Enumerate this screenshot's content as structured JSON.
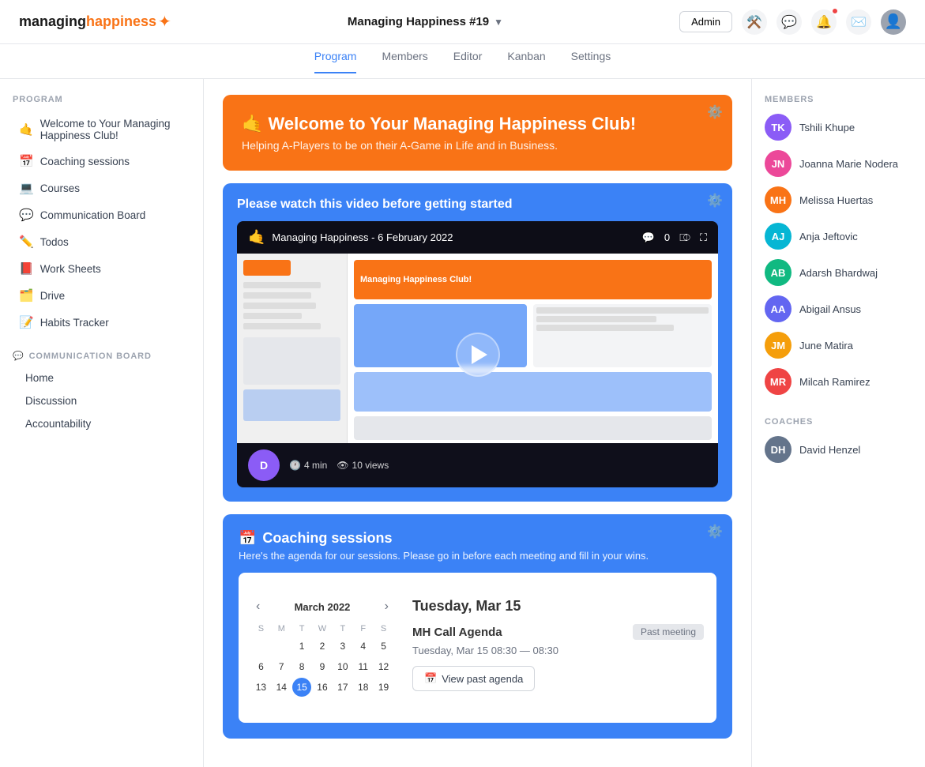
{
  "app": {
    "logo_managing": "managing",
    "logo_happiness": "happiness"
  },
  "topnav": {
    "program_title": "Managing Happiness #19",
    "admin_label": "Admin",
    "icons": {
      "tools": "⚙️",
      "chat": "💬",
      "bell": "🔔",
      "mail": "✉️"
    }
  },
  "tabs": [
    {
      "label": "Program",
      "active": true
    },
    {
      "label": "Members",
      "active": false
    },
    {
      "label": "Editor",
      "active": false
    },
    {
      "label": "Kanban",
      "active": false
    },
    {
      "label": "Settings",
      "active": false
    }
  ],
  "sidebar": {
    "program_title": "PROGRAM",
    "items": [
      {
        "emoji": "🤙",
        "label": "Welcome to Your Managing Happiness Club!"
      },
      {
        "emoji": "📅",
        "label": "Coaching sessions"
      },
      {
        "emoji": "💻",
        "label": "Courses"
      },
      {
        "emoji": "💬",
        "label": "Communication Board"
      },
      {
        "emoji": "✏️",
        "label": "Todos"
      },
      {
        "emoji": "📕",
        "label": "Work Sheets"
      },
      {
        "emoji": "🗂️",
        "label": "Drive"
      },
      {
        "emoji": "📝",
        "label": "Habits Tracker"
      }
    ],
    "comm_board_title": "COMMUNICATION BOARD",
    "comm_board_emoji": "💬",
    "sub_items": [
      {
        "label": "Home"
      },
      {
        "label": "Discussion"
      },
      {
        "label": "Accountability"
      }
    ]
  },
  "welcome_card": {
    "emoji": "🤙",
    "title": "Welcome to Your Managing Happiness Club!",
    "subtitle": "Helping A-Players to be on their A-Game in Life and in Business."
  },
  "video_card": {
    "title": "Please watch this video before getting started",
    "topbar_avatar_emoji": "🤙",
    "topbar_title": "Managing Happiness - 6 February 2022",
    "comment_count": "0",
    "duration": "4 min",
    "views": "10 views"
  },
  "coaching_card": {
    "emoji": "📅",
    "title": "Coaching sessions",
    "subtitle": "Here's the agenda for our sessions. Please go in before each meeting and fill in your wins."
  },
  "calendar": {
    "month_label": "March 2022",
    "day_headers": [
      "S",
      "M",
      "T",
      "W",
      "T",
      "F",
      "S"
    ],
    "weeks": [
      [
        "",
        "",
        "1",
        "2",
        "3",
        "4",
        "5"
      ],
      [
        "6",
        "7",
        "8",
        "9",
        "10",
        "11",
        "12"
      ],
      [
        "13",
        "14",
        "15",
        "16",
        "17",
        "18",
        "19"
      ]
    ],
    "today_day": "15"
  },
  "meeting": {
    "date_label": "Tuesday, Mar 15",
    "name": "MH Call Agenda",
    "status": "Past meeting",
    "time": "Tuesday, Mar 15 08:30 — 08:30",
    "view_agenda_label": "View past agenda",
    "calendar_icon": "📅"
  },
  "members_section": {
    "title": "MEMBERS",
    "members": [
      {
        "name": "Tshili Khupe",
        "color": "#8b5cf6",
        "initials": "TK"
      },
      {
        "name": "Joanna Marie Nodera",
        "color": "#ec4899",
        "initials": "JN"
      },
      {
        "name": "Melissa Huertas",
        "color": "#f97316",
        "initials": "MH"
      },
      {
        "name": "Anja Jeftovic",
        "color": "#06b6d4",
        "initials": "AJ"
      },
      {
        "name": "Adarsh Bhardwaj",
        "color": "#10b981",
        "initials": "AB"
      },
      {
        "name": "Abigail Ansus",
        "color": "#6366f1",
        "initials": "AA"
      },
      {
        "name": "June Matira",
        "color": "#f59e0b",
        "initials": "JM"
      },
      {
        "name": "Milcah Ramirez",
        "color": "#ef4444",
        "initials": "MR"
      }
    ]
  },
  "coaches_section": {
    "title": "COACHES",
    "coaches": [
      {
        "name": "David Henzel",
        "color": "#64748b",
        "initials": "DH"
      }
    ]
  }
}
